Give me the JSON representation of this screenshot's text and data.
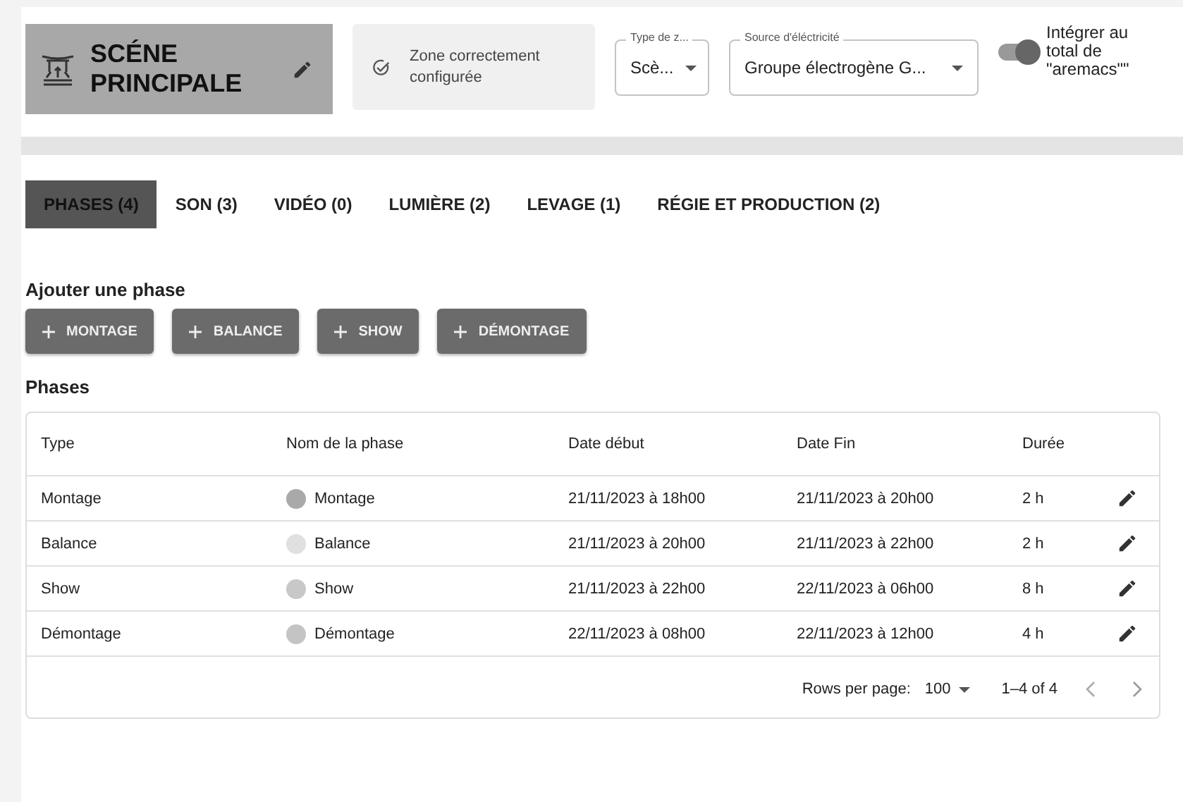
{
  "header": {
    "title": "SCÉNE PRINCIPALE",
    "status": "Zone correctement configurée",
    "type_select": {
      "label": "Type de z...",
      "value": "Scè..."
    },
    "source_select": {
      "label": "Source d'éléctricité",
      "value": "Groupe électrogène G..."
    },
    "toggle": {
      "label": "Intégrer au total de \"aremacs\"\"",
      "on": true
    }
  },
  "tabs": [
    {
      "label": "PHASES (4)",
      "selected": true
    },
    {
      "label": "SON (3)",
      "selected": false
    },
    {
      "label": "VIDÉO (0)",
      "selected": false
    },
    {
      "label": "LUMIÈRE (2)",
      "selected": false
    },
    {
      "label": "LEVAGE (1)",
      "selected": false
    },
    {
      "label": "RÉGIE ET PRODUCTION (2)",
      "selected": false
    }
  ],
  "add_phase": {
    "title": "Ajouter une phase",
    "buttons": [
      "MONTAGE",
      "BALANCE",
      "SHOW",
      "DÉMONTAGE"
    ]
  },
  "table": {
    "title": "Phases",
    "columns": [
      "Type",
      "Nom de la phase",
      "Date début",
      "Date Fin",
      "Durée"
    ],
    "rows": [
      {
        "type": "Montage",
        "name": "Montage",
        "color": "#a9a9a9",
        "start": "21/11/2023 à 18h00",
        "end": "21/11/2023 à 20h00",
        "duration": "2 h"
      },
      {
        "type": "Balance",
        "name": "Balance",
        "color": "#e0e0e0",
        "start": "21/11/2023 à 20h00",
        "end": "21/11/2023 à 22h00",
        "duration": "2 h"
      },
      {
        "type": "Show",
        "name": "Show",
        "color": "#c8c8c8",
        "start": "21/11/2023 à 22h00",
        "end": "22/11/2023 à 06h00",
        "duration": "8 h"
      },
      {
        "type": "Démontage",
        "name": "Démontage",
        "color": "#c4c4c4",
        "start": "22/11/2023 à 08h00",
        "end": "22/11/2023 à 12h00",
        "duration": "4 h"
      }
    ],
    "footer": {
      "rows_label": "Rows per page:",
      "rows_value": "100",
      "range": "1–4 of 4"
    }
  }
}
